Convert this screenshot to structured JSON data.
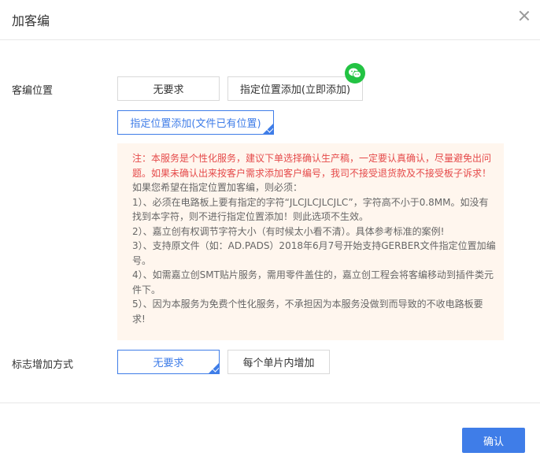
{
  "dialog": {
    "title": "加客编"
  },
  "position": {
    "label": "客编位置",
    "options": [
      "无要求",
      "指定位置添加(立即添加)",
      "指定位置添加(文件已有位置)"
    ],
    "selected": "指定位置添加(文件已有位置)"
  },
  "notice": {
    "warning": "注：本服务是个性化服务，建议下单选择确认生产稿，一定要认真确认，尽量避免出问题。如果未确认出来按客户需求添加客户编号，我司不接受退货款及不接受板子诉求！",
    "intro": "如果您希望在指定位置加客编，则必须：",
    "items": [
      "1）、必须在电路板上要有指定的字符“JLCJLCJLCJLC”，字符高不小于0.8MM。如没有找到本字符，则不进行指定位置添加！则此选项不生效。",
      "2）、嘉立创有权调节字符大小（有时候太小看不清）。具体参考标准的案例!",
      "3）、支持原文件（如：AD.PADS）2018年6月7号开始支持GERBER文件指定位置加编号。",
      "4）、如需嘉立创SMT贴片服务，需用零件盖住的，嘉立创工程会将客编移动到插件类元件下。",
      "5）、因为本服务为免费个性化服务，不承担因为本服务没做到而导致的不收电路板要求!"
    ]
  },
  "marking": {
    "label": "标志增加方式",
    "options": [
      "无要求",
      "每个单片内增加"
    ],
    "selected": "无要求"
  },
  "footer": {
    "confirm_label": "确认"
  },
  "colors": {
    "accent": "#3f7de8",
    "warning_text": "#e54a4a",
    "notice_bg": "#fff6ee",
    "wechat_green": "#23c343"
  },
  "icons": {
    "close": "close-icon",
    "wechat": "wechat-icon",
    "checkmark": "check-corner-icon"
  }
}
